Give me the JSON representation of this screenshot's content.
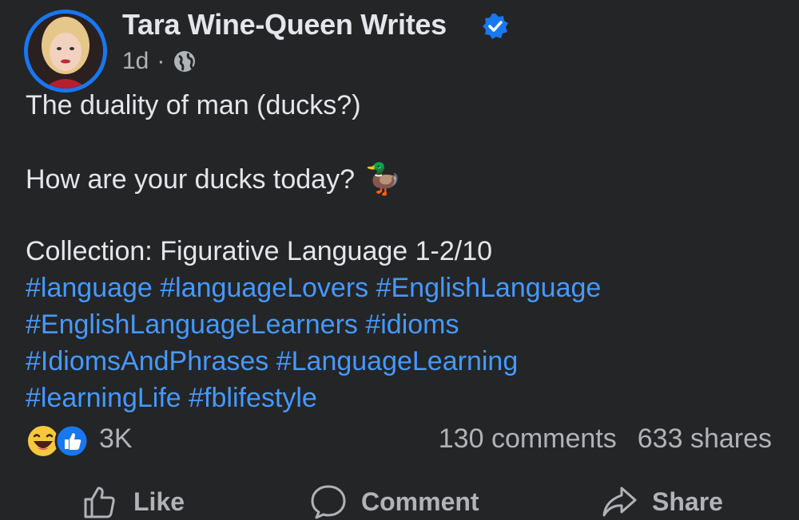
{
  "post": {
    "author": "Tara Wine-Queen Writes",
    "time": "1d",
    "separator": "·",
    "line1": "The duality of man (ducks?)",
    "line2": "How are your ducks today?",
    "line2_emoji": "🦆",
    "line3": "Collection: Figurative Language 1-2/10",
    "hashtags": [
      "#language #languageLovers #EnglishLanguage",
      "#EnglishLanguageLearners #idioms",
      "#IdiomsAndPhrases #LanguageLearning",
      "#learningLife #fblifestyle"
    ]
  },
  "engagement": {
    "reaction_count": "3K",
    "comments": "130 comments",
    "shares": "633 shares"
  },
  "actions": {
    "like": "Like",
    "comment": "Comment",
    "share": "Share"
  },
  "colors": {
    "background": "#242526",
    "link": "#4599ff",
    "accent": "#1877f2",
    "muted": "#b0b3b8"
  }
}
